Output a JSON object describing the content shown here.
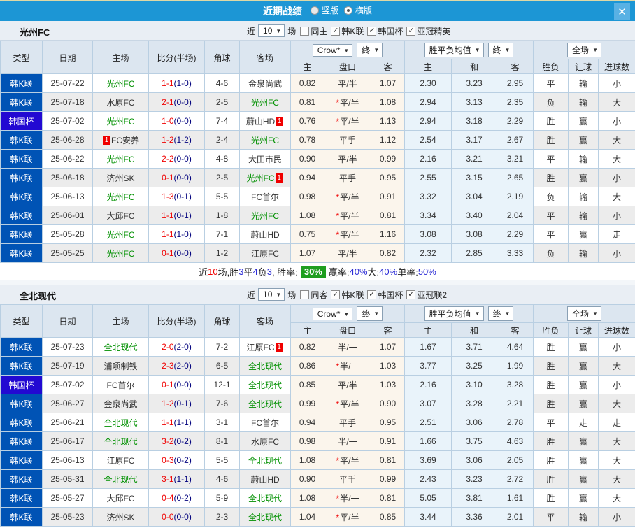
{
  "titlebar": {
    "title": "近期战绩",
    "radios": [
      {
        "label": "竖版",
        "selected": false
      },
      {
        "label": "横版",
        "selected": true
      }
    ],
    "close_icon": "✕"
  },
  "table_header": {
    "main": [
      "类型",
      "日期",
      "主场",
      "比分(半场)",
      "角球",
      "客场"
    ],
    "sub": [
      "主",
      "盘口",
      "客",
      "主",
      "和",
      "客",
      "胜负",
      "让球",
      "进球数"
    ],
    "selects": {
      "asian": [
        "Crow*",
        "终"
      ],
      "euro": [
        "胜平负均值",
        "终"
      ],
      "scope": [
        "全场"
      ]
    }
  },
  "colors": {
    "titlebar": "#1c96d5",
    "league_badge": "#0053b5",
    "cup_badge": "#2209d2",
    "team_highlight": "#009000",
    "score_red": "#f00000",
    "half_score_navy": "#00007d",
    "win_red": "#f00000",
    "draw_blue": "#1a1ae6",
    "lose_green": "#009000",
    "asian_cols_bg": "#fbf5ec",
    "euro_cols_bg": "#e9f3fa",
    "winrate_badge_bg": "#1f9e1f"
  },
  "sections": [
    {
      "team": "光州FC",
      "filters": {
        "near": "近",
        "count": "10",
        "unit": "场",
        "same_label": "同主",
        "same_checked": false,
        "leagues": [
          {
            "label": "韩K联",
            "checked": true
          },
          {
            "label": "韩国杯",
            "checked": true
          },
          {
            "label": "亚冠精英",
            "checked": true
          }
        ]
      },
      "rows": [
        {
          "type": "韩K联",
          "date": "25-07-22",
          "home": "光州FC",
          "home_green": true,
          "home_badge": "",
          "score": "1-1",
          "half": "(1-0)",
          "corners": "4-6",
          "away": "金泉尚武",
          "away_green": false,
          "away_badge": "",
          "ah": [
            "0.82",
            "平/半",
            "1.07"
          ],
          "star": false,
          "eu": [
            "2.30",
            "3.23",
            "2.95"
          ],
          "res": [
            [
              "平",
              "blue"
            ],
            [
              "输",
              "green"
            ],
            [
              "小",
              "green"
            ]
          ]
        },
        {
          "type": "韩K联",
          "date": "25-07-18",
          "home": "水原FC",
          "home_green": false,
          "home_badge": "",
          "score": "2-1",
          "half": "(0-0)",
          "corners": "2-5",
          "away": "光州FC",
          "away_green": true,
          "away_badge": "",
          "ah": [
            "0.81",
            "平/半",
            "1.08"
          ],
          "star": true,
          "eu": [
            "2.94",
            "3.13",
            "2.35"
          ],
          "res": [
            [
              "负",
              "green"
            ],
            [
              "输",
              "green"
            ],
            [
              "大",
              "red"
            ]
          ]
        },
        {
          "type": "韩国杯",
          "date": "25-07-02",
          "home": "光州FC",
          "home_green": true,
          "home_badge": "",
          "score": "1-0",
          "half": "(0-0)",
          "corners": "7-4",
          "away": "蔚山HD",
          "away_green": false,
          "away_badge": "1",
          "ah": [
            "0.76",
            "平/半",
            "1.13"
          ],
          "star": true,
          "eu": [
            "2.94",
            "3.18",
            "2.29"
          ],
          "res": [
            [
              "胜",
              "red"
            ],
            [
              "赢",
              "red"
            ],
            [
              "小",
              "green"
            ]
          ]
        },
        {
          "type": "韩K联",
          "date": "25-06-28",
          "home": "FC安养",
          "home_green": false,
          "home_badge": "1",
          "score": "1-2",
          "half": "(1-2)",
          "corners": "2-4",
          "away": "光州FC",
          "away_green": true,
          "away_badge": "",
          "ah": [
            "0.78",
            "平手",
            "1.12"
          ],
          "star": false,
          "eu": [
            "2.54",
            "3.17",
            "2.67"
          ],
          "res": [
            [
              "胜",
              "red"
            ],
            [
              "赢",
              "red"
            ],
            [
              "大",
              "red"
            ]
          ]
        },
        {
          "type": "韩K联",
          "date": "25-06-22",
          "home": "光州FC",
          "home_green": true,
          "home_badge": "",
          "score": "2-2",
          "half": "(0-0)",
          "corners": "4-8",
          "away": "大田市民",
          "away_green": false,
          "away_badge": "",
          "ah": [
            "0.90",
            "平/半",
            "0.99"
          ],
          "star": false,
          "eu": [
            "2.16",
            "3.21",
            "3.21"
          ],
          "res": [
            [
              "平",
              "blue"
            ],
            [
              "输",
              "green"
            ],
            [
              "大",
              "red"
            ]
          ]
        },
        {
          "type": "韩K联",
          "date": "25-06-18",
          "home": "济州SK",
          "home_green": false,
          "home_badge": "",
          "score": "0-1",
          "half": "(0-0)",
          "corners": "2-5",
          "away": "光州FC",
          "away_green": true,
          "away_badge": "1",
          "ah": [
            "0.94",
            "平手",
            "0.95"
          ],
          "star": false,
          "eu": [
            "2.55",
            "3.15",
            "2.65"
          ],
          "res": [
            [
              "胜",
              "red"
            ],
            [
              "赢",
              "red"
            ],
            [
              "小",
              "green"
            ]
          ]
        },
        {
          "type": "韩K联",
          "date": "25-06-13",
          "home": "光州FC",
          "home_green": true,
          "home_badge": "",
          "score": "1-3",
          "half": "(0-1)",
          "corners": "5-5",
          "away": "FC首尔",
          "away_green": false,
          "away_badge": "",
          "ah": [
            "0.98",
            "平/半",
            "0.91"
          ],
          "star": true,
          "eu": [
            "3.32",
            "3.04",
            "2.19"
          ],
          "res": [
            [
              "负",
              "green"
            ],
            [
              "输",
              "green"
            ],
            [
              "大",
              "red"
            ]
          ]
        },
        {
          "type": "韩K联",
          "date": "25-06-01",
          "home": "大邱FC",
          "home_green": false,
          "home_badge": "",
          "score": "1-1",
          "half": "(0-1)",
          "corners": "1-8",
          "away": "光州FC",
          "away_green": true,
          "away_badge": "",
          "ah": [
            "1.08",
            "平/半",
            "0.81"
          ],
          "star": true,
          "eu": [
            "3.34",
            "3.40",
            "2.04"
          ],
          "res": [
            [
              "平",
              "blue"
            ],
            [
              "输",
              "green"
            ],
            [
              "小",
              "green"
            ]
          ]
        },
        {
          "type": "韩K联",
          "date": "25-05-28",
          "home": "光州FC",
          "home_green": true,
          "home_badge": "",
          "score": "1-1",
          "half": "(1-0)",
          "corners": "7-1",
          "away": "蔚山HD",
          "away_green": false,
          "away_badge": "",
          "ah": [
            "0.75",
            "平/半",
            "1.16"
          ],
          "star": true,
          "eu": [
            "3.08",
            "3.08",
            "2.29"
          ],
          "res": [
            [
              "平",
              "blue"
            ],
            [
              "赢",
              "red"
            ],
            [
              "走",
              "blue"
            ]
          ]
        },
        {
          "type": "韩K联",
          "date": "25-05-25",
          "home": "光州FC",
          "home_green": true,
          "home_badge": "",
          "score": "0-1",
          "half": "(0-0)",
          "corners": "1-2",
          "away": "江原FC",
          "away_green": false,
          "away_badge": "",
          "ah": [
            "1.07",
            "平/半",
            "0.82"
          ],
          "star": false,
          "eu": [
            "2.32",
            "2.85",
            "3.33"
          ],
          "res": [
            [
              "负",
              "green"
            ],
            [
              "输",
              "green"
            ],
            [
              "小",
              "green"
            ]
          ]
        }
      ],
      "summary": {
        "segments": [
          {
            "text": "近",
            "color": "black"
          },
          {
            "text": "10",
            "color": "red"
          },
          {
            "text": "场,胜",
            "color": "black"
          },
          {
            "text": "3",
            "color": "blue"
          },
          {
            "text": "平",
            "color": "black"
          },
          {
            "text": "4",
            "color": "blue"
          },
          {
            "text": "负",
            "color": "black"
          },
          {
            "text": "3",
            "color": "blue"
          },
          {
            "text": ", 胜率: ",
            "color": "black"
          },
          {
            "text": "30%",
            "color": "greenbadge"
          },
          {
            "text": " 赢率:",
            "color": "black"
          },
          {
            "text": "40%",
            "color": "blue"
          },
          {
            "text": " 大:",
            "color": "black"
          },
          {
            "text": "40%",
            "color": "blue"
          },
          {
            "text": " 单率:",
            "color": "black"
          },
          {
            "text": "50%",
            "color": "blue"
          }
        ]
      }
    },
    {
      "team": "全北现代",
      "filters": {
        "near": "近",
        "count": "10",
        "unit": "场",
        "same_label": "同客",
        "same_checked": false,
        "leagues": [
          {
            "label": "韩K联",
            "checked": true
          },
          {
            "label": "韩国杯",
            "checked": true
          },
          {
            "label": "亚冠联2",
            "checked": true
          }
        ]
      },
      "rows": [
        {
          "type": "韩K联",
          "date": "25-07-23",
          "home": "全北现代",
          "home_green": true,
          "home_badge": "",
          "score": "2-0",
          "half": "(2-0)",
          "corners": "7-2",
          "away": "江原FC",
          "away_green": false,
          "away_badge": "1",
          "ah": [
            "0.82",
            "半/一",
            "1.07"
          ],
          "star": false,
          "eu": [
            "1.67",
            "3.71",
            "4.64"
          ],
          "res": [
            [
              "胜",
              "red"
            ],
            [
              "赢",
              "red"
            ],
            [
              "小",
              "green"
            ]
          ]
        },
        {
          "type": "韩K联",
          "date": "25-07-19",
          "home": "浦项制铁",
          "home_green": false,
          "home_badge": "",
          "score": "2-3",
          "half": "(2-0)",
          "corners": "6-5",
          "away": "全北现代",
          "away_green": true,
          "away_badge": "",
          "ah": [
            "0.86",
            "半/一",
            "1.03"
          ],
          "star": true,
          "eu": [
            "3.77",
            "3.25",
            "1.99"
          ],
          "res": [
            [
              "胜",
              "red"
            ],
            [
              "赢",
              "red"
            ],
            [
              "大",
              "red"
            ]
          ]
        },
        {
          "type": "韩国杯",
          "date": "25-07-02",
          "home": "FC首尔",
          "home_green": false,
          "home_badge": "",
          "score": "0-1",
          "half": "(0-0)",
          "corners": "12-1",
          "away": "全北现代",
          "away_green": true,
          "away_badge": "",
          "ah": [
            "0.85",
            "平/半",
            "1.03"
          ],
          "star": false,
          "eu": [
            "2.16",
            "3.10",
            "3.28"
          ],
          "res": [
            [
              "胜",
              "red"
            ],
            [
              "赢",
              "red"
            ],
            [
              "小",
              "green"
            ]
          ]
        },
        {
          "type": "韩K联",
          "date": "25-06-27",
          "home": "金泉尚武",
          "home_green": false,
          "home_badge": "",
          "score": "1-2",
          "half": "(0-1)",
          "corners": "7-6",
          "away": "全北现代",
          "away_green": true,
          "away_badge": "",
          "ah": [
            "0.99",
            "平/半",
            "0.90"
          ],
          "star": true,
          "eu": [
            "3.07",
            "3.28",
            "2.21"
          ],
          "res": [
            [
              "胜",
              "red"
            ],
            [
              "赢",
              "red"
            ],
            [
              "大",
              "red"
            ]
          ]
        },
        {
          "type": "韩K联",
          "date": "25-06-21",
          "home": "全北现代",
          "home_green": true,
          "home_badge": "",
          "score": "1-1",
          "half": "(1-1)",
          "corners": "3-1",
          "away": "FC首尔",
          "away_green": false,
          "away_badge": "",
          "ah": [
            "0.94",
            "平手",
            "0.95"
          ],
          "star": false,
          "eu": [
            "2.51",
            "3.06",
            "2.78"
          ],
          "res": [
            [
              "平",
              "blue"
            ],
            [
              "走",
              "blue"
            ],
            [
              "走",
              "blue"
            ]
          ]
        },
        {
          "type": "韩K联",
          "date": "25-06-17",
          "home": "全北现代",
          "home_green": true,
          "home_badge": "",
          "score": "3-2",
          "half": "(0-2)",
          "corners": "8-1",
          "away": "水原FC",
          "away_green": false,
          "away_badge": "",
          "ah": [
            "0.98",
            "半/一",
            "0.91"
          ],
          "star": false,
          "eu": [
            "1.66",
            "3.75",
            "4.63"
          ],
          "res": [
            [
              "胜",
              "red"
            ],
            [
              "赢",
              "red"
            ],
            [
              "大",
              "red"
            ]
          ]
        },
        {
          "type": "韩K联",
          "date": "25-06-13",
          "home": "江原FC",
          "home_green": false,
          "home_badge": "",
          "score": "0-3",
          "half": "(0-2)",
          "corners": "5-5",
          "away": "全北现代",
          "away_green": true,
          "away_badge": "",
          "ah": [
            "1.08",
            "平/半",
            "0.81"
          ],
          "star": true,
          "eu": [
            "3.69",
            "3.06",
            "2.05"
          ],
          "res": [
            [
              "胜",
              "red"
            ],
            [
              "赢",
              "red"
            ],
            [
              "大",
              "red"
            ]
          ]
        },
        {
          "type": "韩K联",
          "date": "25-05-31",
          "home": "全北现代",
          "home_green": true,
          "home_badge": "",
          "score": "3-1",
          "half": "(1-1)",
          "corners": "4-6",
          "away": "蔚山HD",
          "away_green": false,
          "away_badge": "",
          "ah": [
            "0.90",
            "平手",
            "0.99"
          ],
          "star": false,
          "eu": [
            "2.43",
            "3.23",
            "2.72"
          ],
          "res": [
            [
              "胜",
              "red"
            ],
            [
              "赢",
              "red"
            ],
            [
              "大",
              "red"
            ]
          ]
        },
        {
          "type": "韩K联",
          "date": "25-05-27",
          "home": "大邱FC",
          "home_green": false,
          "home_badge": "",
          "score": "0-4",
          "half": "(0-2)",
          "corners": "5-9",
          "away": "全北现代",
          "away_green": true,
          "away_badge": "",
          "ah": [
            "1.08",
            "半/一",
            "0.81"
          ],
          "star": true,
          "eu": [
            "5.05",
            "3.81",
            "1.61"
          ],
          "res": [
            [
              "胜",
              "red"
            ],
            [
              "赢",
              "red"
            ],
            [
              "大",
              "red"
            ]
          ]
        },
        {
          "type": "韩K联",
          "date": "25-05-23",
          "home": "济州SK",
          "home_green": false,
          "home_badge": "",
          "score": "0-0",
          "half": "(0-0)",
          "corners": "2-3",
          "away": "全北现代",
          "away_green": true,
          "away_badge": "",
          "ah": [
            "1.04",
            "平/半",
            "0.85"
          ],
          "star": true,
          "eu": [
            "3.44",
            "3.36",
            "2.01"
          ],
          "res": [
            [
              "平",
              "blue"
            ],
            [
              "输",
              "green"
            ],
            [
              "小",
              "green"
            ]
          ]
        }
      ]
    }
  ]
}
